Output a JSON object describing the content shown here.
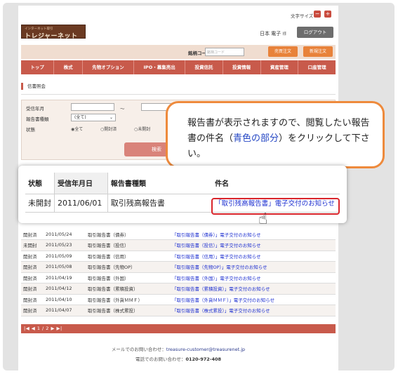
{
  "header": {
    "font_size_label": "文字サイズ",
    "font_minus": "−",
    "font_plus": "+",
    "logo_small": "インターネット取引",
    "logo_big": "トレジャーネット",
    "user_name": "日本 電子",
    "user_suffix": "様",
    "logout_label": "ログアウト"
  },
  "orderbar": {
    "code_label": "銘柄コード",
    "code_placeholder": "銘柄コード",
    "buy_sell_label": "売買注文",
    "new_order_label": "新規注文"
  },
  "nav": [
    "トップ",
    "株式",
    "先物オプション",
    "IPO・募集売出",
    "投資信託",
    "投資情報",
    "資産管理",
    "口座管理"
  ],
  "section_title": "信書照会",
  "search": {
    "date_label": "受信年月",
    "tilde": "～",
    "type_label": "報告書種類",
    "type_value": "(全て)",
    "status_label": "状態",
    "radio_all": "◉全て",
    "radio_opened": "○開封済",
    "radio_unopened": "○未開封",
    "search_button": "検索"
  },
  "callout": {
    "text_before": "報告書が表示されますので、閲覧したい報告書の件名（",
    "text_highlight": "青色の部分",
    "text_after": "）をクリックして下さい。"
  },
  "zoom_table": {
    "headers": [
      "状態",
      "受信年月日",
      "報告書種類",
      "件名"
    ],
    "row": [
      "未開封",
      "2011/06/01",
      "取引残高報告書",
      "「取引残高報告書」電子交付のお知らせ"
    ]
  },
  "list_rows": [
    [
      "開封済",
      "2011/05/24",
      "取引報告書（債券）",
      "「取引報告書（債券）」電子交付のお知らせ"
    ],
    [
      "未開封",
      "2011/05/23",
      "取引報告書（投信）",
      "「取引報告書（投信）」電子交付のお知らせ"
    ],
    [
      "開封済",
      "2011/05/09",
      "取引報告書（信用）",
      "「取引報告書（信用）」電子交付のお知らせ"
    ],
    [
      "開封済",
      "2011/05/08",
      "取引報告書（先物OP）",
      "「取引報告書（先物OP）」電子交付のお知らせ"
    ],
    [
      "開封済",
      "2011/04/19",
      "取引報告書（外国）",
      "「取引報告書（外国）」電子交付のお知らせ"
    ],
    [
      "開封済",
      "2011/04/12",
      "取引報告書（累積投資）",
      "「取引報告書（累積投資）」電子交付のお知らせ"
    ],
    [
      "開封済",
      "2011/04/10",
      "取引報告書（外貨ＭＭＦ）",
      "「取引報告書（外貨ＭＭＦ）」電子交付のお知らせ"
    ],
    [
      "開封済",
      "2011/04/07",
      "取引報告書（株式累投）",
      "「取引報告書（株式累投）」電子交付のお知らせ"
    ]
  ],
  "pager": "|◀ ◀ 1 / 2 ▶ ▶|",
  "footer": {
    "mail_label": "メールでのお問い合わせ：",
    "mail": "treasure-customer@treasurenet.jp",
    "phone_label": "電話でのお問い合わせ：",
    "phone": "0120-972-408"
  }
}
